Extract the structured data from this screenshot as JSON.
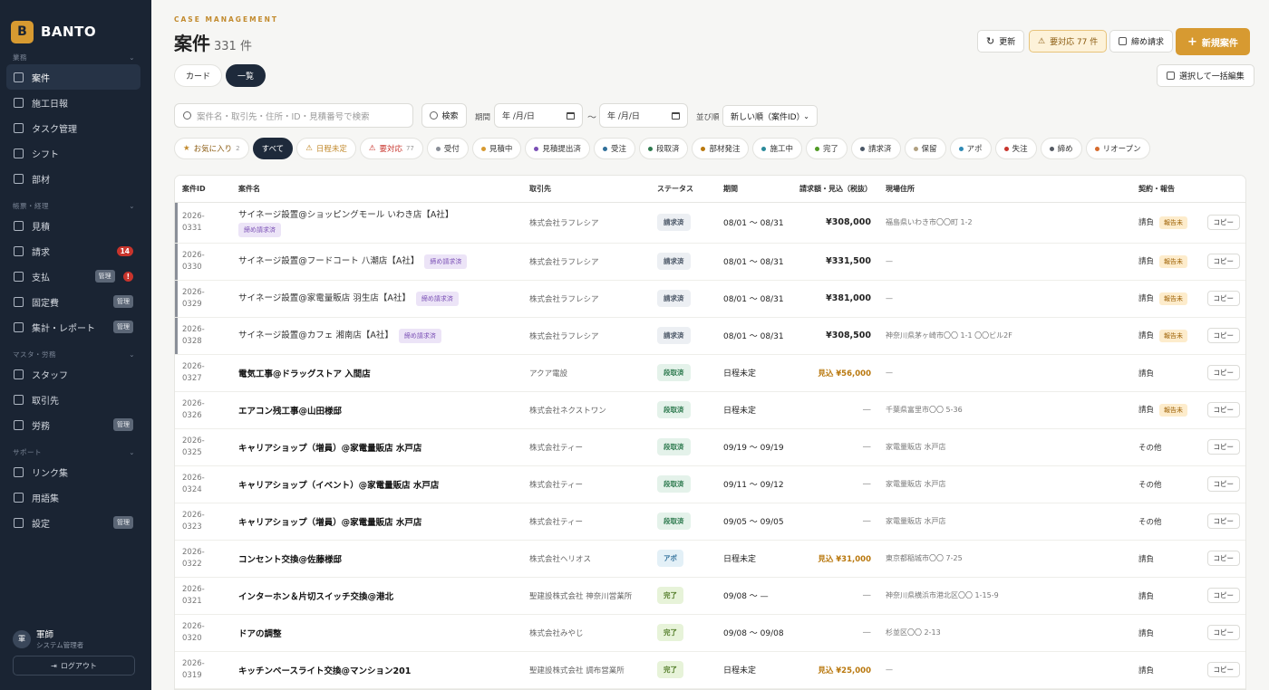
{
  "brand": {
    "logo": "B",
    "name": "BANTO"
  },
  "nav": {
    "sections": [
      {
        "title": "業務",
        "items": [
          {
            "label": "案件",
            "icon": "folder-icon"
          },
          {
            "label": "施工日報",
            "icon": "calendar-icon"
          },
          {
            "label": "タスク管理",
            "icon": "check-circle-icon"
          },
          {
            "label": "シフト",
            "icon": "grid-icon"
          },
          {
            "label": "部材",
            "icon": "box-icon"
          }
        ]
      },
      {
        "title": "帳票・経理",
        "items": [
          {
            "label": "見積",
            "icon": "document-icon"
          },
          {
            "label": "請求",
            "icon": "invoice-icon",
            "badge": "14"
          },
          {
            "label": "支払",
            "icon": "card-icon",
            "admin": "管理",
            "badge": "!"
          },
          {
            "label": "固定費",
            "icon": "repeat-icon",
            "admin": "管理"
          },
          {
            "label": "集計・レポート",
            "icon": "chart-icon",
            "admin": "管理"
          }
        ]
      },
      {
        "title": "マスタ・労務",
        "items": [
          {
            "label": "スタッフ",
            "icon": "user-plus-icon"
          },
          {
            "label": "取引先",
            "icon": "building-icon"
          },
          {
            "label": "労務",
            "icon": "clipboard-icon",
            "admin": "管理"
          }
        ]
      },
      {
        "title": "サポート",
        "items": [
          {
            "label": "リンク集",
            "icon": "link-icon"
          },
          {
            "label": "用語集",
            "icon": "book-icon"
          },
          {
            "label": "設定",
            "icon": "gear-icon",
            "admin": "管理"
          }
        ]
      }
    ]
  },
  "user": {
    "avatar": "軍",
    "name": "軍師",
    "role": "システム管理者",
    "logout": "ログアウト"
  },
  "header": {
    "kicker": "CASE MANAGEMENT",
    "title": "案件",
    "count": "331 件",
    "refresh": "更新",
    "warn": "要対応 77 件",
    "closing": "締め請求",
    "new_case": "新規案件"
  },
  "views": {
    "card": "カード",
    "list": "一覧"
  },
  "bulk_edit": "選択して一括編集",
  "filters": {
    "search_placeholder": "案件名・取引先・住所・ID・見積番号で検索",
    "search_button": "検索",
    "period_label": "期間",
    "date_from": "年 /月/日",
    "date_to": "年 /月/日",
    "tilde": "〜",
    "sort_label": "並び順",
    "sort_value": "新しい順（案件ID）"
  },
  "chips": [
    {
      "label": "お気に入り",
      "count": "2",
      "icon": "star-icon",
      "color": "#c28a2d"
    },
    {
      "label": "すべて",
      "active": true
    },
    {
      "label": "日程未定",
      "icon": "warning-icon",
      "color": "#c28a2d"
    },
    {
      "label": "要対応",
      "count": "77",
      "icon": "warning-icon",
      "color": "#c8342c"
    },
    {
      "label": "受付",
      "dot": "#8a8f98"
    },
    {
      "label": "見積中",
      "dot": "#d79a31"
    },
    {
      "label": "見積提出済",
      "dot": "#7a4fb5"
    },
    {
      "label": "受注",
      "dot": "#2f6f9a"
    },
    {
      "label": "段取済",
      "dot": "#2e7a4f"
    },
    {
      "label": "部材発注",
      "dot": "#b9780e"
    },
    {
      "label": "施工中",
      "dot": "#2a8a9a"
    },
    {
      "label": "完了",
      "dot": "#4f9a24"
    },
    {
      "label": "請求済",
      "dot": "#4a5666"
    },
    {
      "label": "保留",
      "dot": "#b0a080"
    },
    {
      "label": "アポ",
      "dot": "#2f8ab5"
    },
    {
      "label": "失注",
      "dot": "#c8342c"
    },
    {
      "label": "締め",
      "dot": "#555a63"
    },
    {
      "label": "リオープン",
      "dot": "#d66a2c"
    }
  ],
  "table": {
    "headers": [
      "案件ID",
      "案件名",
      "取引先",
      "ステータス",
      "期間",
      "請求額・見込（税抜）",
      "現場住所",
      "契約・報告"
    ],
    "copy_label": "コピー",
    "rows": [
      {
        "id1": "2026-0331",
        "id2": "",
        "name": "サイネージ設置@ショッピングモール いわき店【A社】",
        "tag": "締め請求済",
        "tag_block": true,
        "client": "株式会社ラフレシア",
        "status": "請求済",
        "st": "seikyu",
        "period": "08/01 〜 08/31",
        "amount": "¥308,000",
        "amt": "normal",
        "addr": "福島県いわき市〇〇町 1-2",
        "contract": "請負",
        "report": "報告未",
        "bold": false,
        "marked": true
      },
      {
        "id1": "2026-",
        "id2": "0330",
        "name": "サイネージ設置@フードコート 八潮店【A社】",
        "tag": "締め請求済",
        "client": "株式会社ラフレシア",
        "status": "請求済",
        "st": "seikyu",
        "period": "08/01 〜 08/31",
        "amount": "¥331,500",
        "amt": "normal",
        "addr": "—",
        "contract": "請負",
        "report": "報告未",
        "bold": false,
        "marked": true
      },
      {
        "id1": "2026-",
        "id2": "0329",
        "name": "サイネージ設置@家電量販店 羽生店【A社】",
        "tag": "締め請求済",
        "client": "株式会社ラフレシア",
        "status": "請求済",
        "st": "seikyu",
        "period": "08/01 〜 08/31",
        "amount": "¥381,000",
        "amt": "normal",
        "addr": "—",
        "contract": "請負",
        "report": "報告未",
        "bold": false,
        "marked": true
      },
      {
        "id1": "2026-",
        "id2": "0328",
        "name": "サイネージ設置@カフェ 湘南店【A社】",
        "tag": "締め請求済",
        "client": "株式会社ラフレシア",
        "status": "請求済",
        "st": "seikyu",
        "period": "08/01 〜 08/31",
        "amount": "¥308,500",
        "amt": "normal",
        "addr": "神奈川県茅ヶ崎市〇〇 1-1 〇〇ビル2F",
        "contract": "請負",
        "report": "報告未",
        "bold": false,
        "marked": true
      },
      {
        "id1": "2026-",
        "id2": "0327",
        "name": "電気工事@ドラッグストア 入間店",
        "client": "アクア電設",
        "status": "段取済",
        "st": "dantori",
        "period": "日程未定",
        "amount": "見込 ¥56,000",
        "amt": "est",
        "addr": "—",
        "contract": "請負",
        "bold": true
      },
      {
        "id1": "2026-",
        "id2": "0326",
        "name": "エアコン残工事@山田様邸",
        "client": "株式会社ネクストワン",
        "status": "段取済",
        "st": "dantori",
        "period": "日程未定",
        "amount": "—",
        "amt": "dash",
        "addr": "千葉県富里市〇〇 5-36",
        "contract": "請負",
        "report": "報告未",
        "bold": true
      },
      {
        "id1": "2026-",
        "id2": "0325",
        "name": "キャリアショップ（増員）@家電量販店 水戸店",
        "client": "株式会社ティー",
        "status": "段取済",
        "st": "dantori",
        "period": "09/19 〜 09/19",
        "amount": "—",
        "amt": "dash",
        "addr": "家電量販店 水戸店",
        "contract": "その他",
        "bold": true
      },
      {
        "id1": "2026-",
        "id2": "0324",
        "name": "キャリアショップ（イベント）@家電量販店 水戸店",
        "client": "株式会社ティー",
        "status": "段取済",
        "st": "dantori",
        "period": "09/11 〜 09/12",
        "amount": "—",
        "amt": "dash",
        "addr": "家電量販店 水戸店",
        "contract": "その他",
        "bold": true
      },
      {
        "id1": "2026-",
        "id2": "0323",
        "name": "キャリアショップ（増員）@家電量販店 水戸店",
        "client": "株式会社ティー",
        "status": "段取済",
        "st": "dantori",
        "period": "09/05 〜 09/05",
        "amount": "—",
        "amt": "dash",
        "addr": "家電量販店 水戸店",
        "contract": "その他",
        "bold": true
      },
      {
        "id1": "2026-",
        "id2": "0322",
        "name": "コンセント交換@佐藤様邸",
        "client": "株式会社ヘリオス",
        "status": "アポ",
        "st": "apo",
        "period": "日程未定",
        "amount": "見込 ¥31,000",
        "amt": "est",
        "addr": "東京都稲城市〇〇 7-25",
        "contract": "請負",
        "bold": true
      },
      {
        "id1": "2026-0321",
        "id2": "",
        "name": "インターホン＆片切スイッチ交換@港北",
        "client": "聖建設株式会社 神奈川営業所",
        "status": "完了",
        "st": "kanryo",
        "period": "09/08 〜 —",
        "amount": "—",
        "amt": "dash",
        "addr": "神奈川県横浜市港北区〇〇 1-15-9",
        "contract": "請負",
        "bold": true
      },
      {
        "id1": "2026-",
        "id2": "0320",
        "name": "ドアの調整",
        "client": "株式会社みやじ",
        "status": "完了",
        "st": "kanryo",
        "period": "09/08 〜 09/08",
        "amount": "—",
        "amt": "dash",
        "addr": "杉並区〇〇 2-13",
        "contract": "請負",
        "bold": true
      },
      {
        "id1": "2026-0319",
        "id2": "",
        "name": "キッチンベースライト交換@マンション201",
        "client": "聖建設株式会社 調布営業所",
        "status": "完了",
        "st": "kanryo",
        "period": "日程未定",
        "amount": "見込 ¥25,000",
        "amt": "est",
        "addr": "—",
        "contract": "請負",
        "bold": true
      }
    ]
  }
}
